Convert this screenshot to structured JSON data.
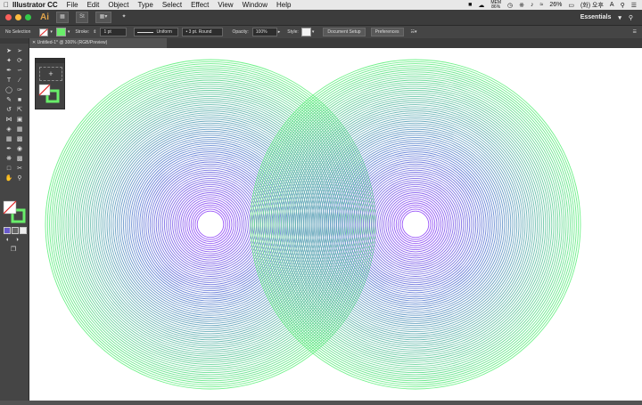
{
  "menubar": {
    "app_name": "Illustrator CC",
    "menus": [
      "File",
      "Edit",
      "Object",
      "Type",
      "Select",
      "Effect",
      "View",
      "Window",
      "Help"
    ],
    "mem_label": "MEM",
    "mem_value": "86%",
    "battery": "26%",
    "clock": "(화) 오후",
    "input_source": "A"
  },
  "appbar": {
    "logo": "Ai",
    "bridge_icon": "St",
    "workspace": "Essentials"
  },
  "control": {
    "selection": "No Selection",
    "stroke_label": "Stroke:",
    "stroke_value": "1 pt",
    "profile": "Uniform",
    "brush": "3 pt. Round",
    "opacity_label": "Opacity:",
    "opacity_value": "100%",
    "style_label": "Style:",
    "document_setup": "Document Setup",
    "preferences": "Preferences",
    "fill_color": "#ffffff",
    "stroke_color": "#69ee6a"
  },
  "document": {
    "tab_title": "Untitled-1* @ 300% (RGB/Preview)"
  },
  "art": {
    "outer_color": "#5ff07c",
    "inner_color": "#9a38ff",
    "mid_color": "#5b7cd2"
  }
}
